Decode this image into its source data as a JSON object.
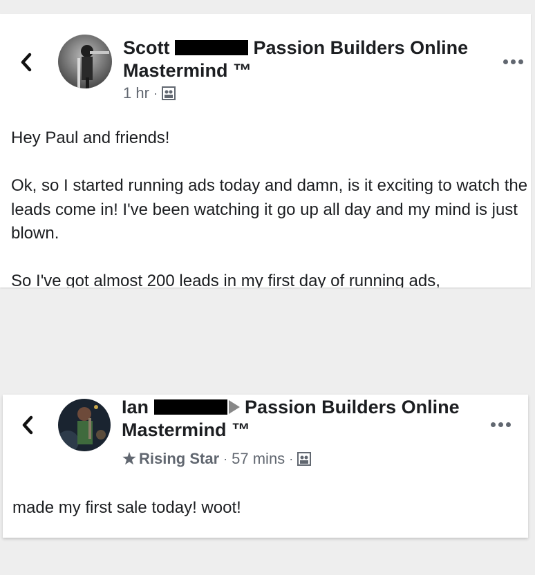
{
  "post1": {
    "author_first": "Scott",
    "group_name": "Passion Builders Online",
    "group_name_line2": "Mastermind ™",
    "time": "1 hr",
    "dot": "·",
    "greeting": "Hey Paul and friends!",
    "paragraph1": "Ok, so I started running ads today and damn, is it exciting to watch the leads come in! I've been watching it go up all day and my mind is just blown.",
    "paragraph2": "So I've got almost 200 leads in my first day of running ads,",
    "icons": {
      "back": "chevron-left-icon",
      "privacy": "group-members-icon",
      "more": "more-options-icon"
    }
  },
  "post2": {
    "author_first": "Ian",
    "group_name": "Passion Builders Online",
    "group_name_line2": "Mastermind ™",
    "badge": "Rising Star",
    "time": "57 mins",
    "dot": "·",
    "message": "made my first sale today! woot!",
    "icons": {
      "back": "chevron-left-icon",
      "badge": "rising-star-icon",
      "privacy": "group-members-icon",
      "more": "more-options-icon"
    }
  },
  "colors": {
    "text": "#1c1e21",
    "meta": "#616770",
    "background": "#eeeeee"
  }
}
